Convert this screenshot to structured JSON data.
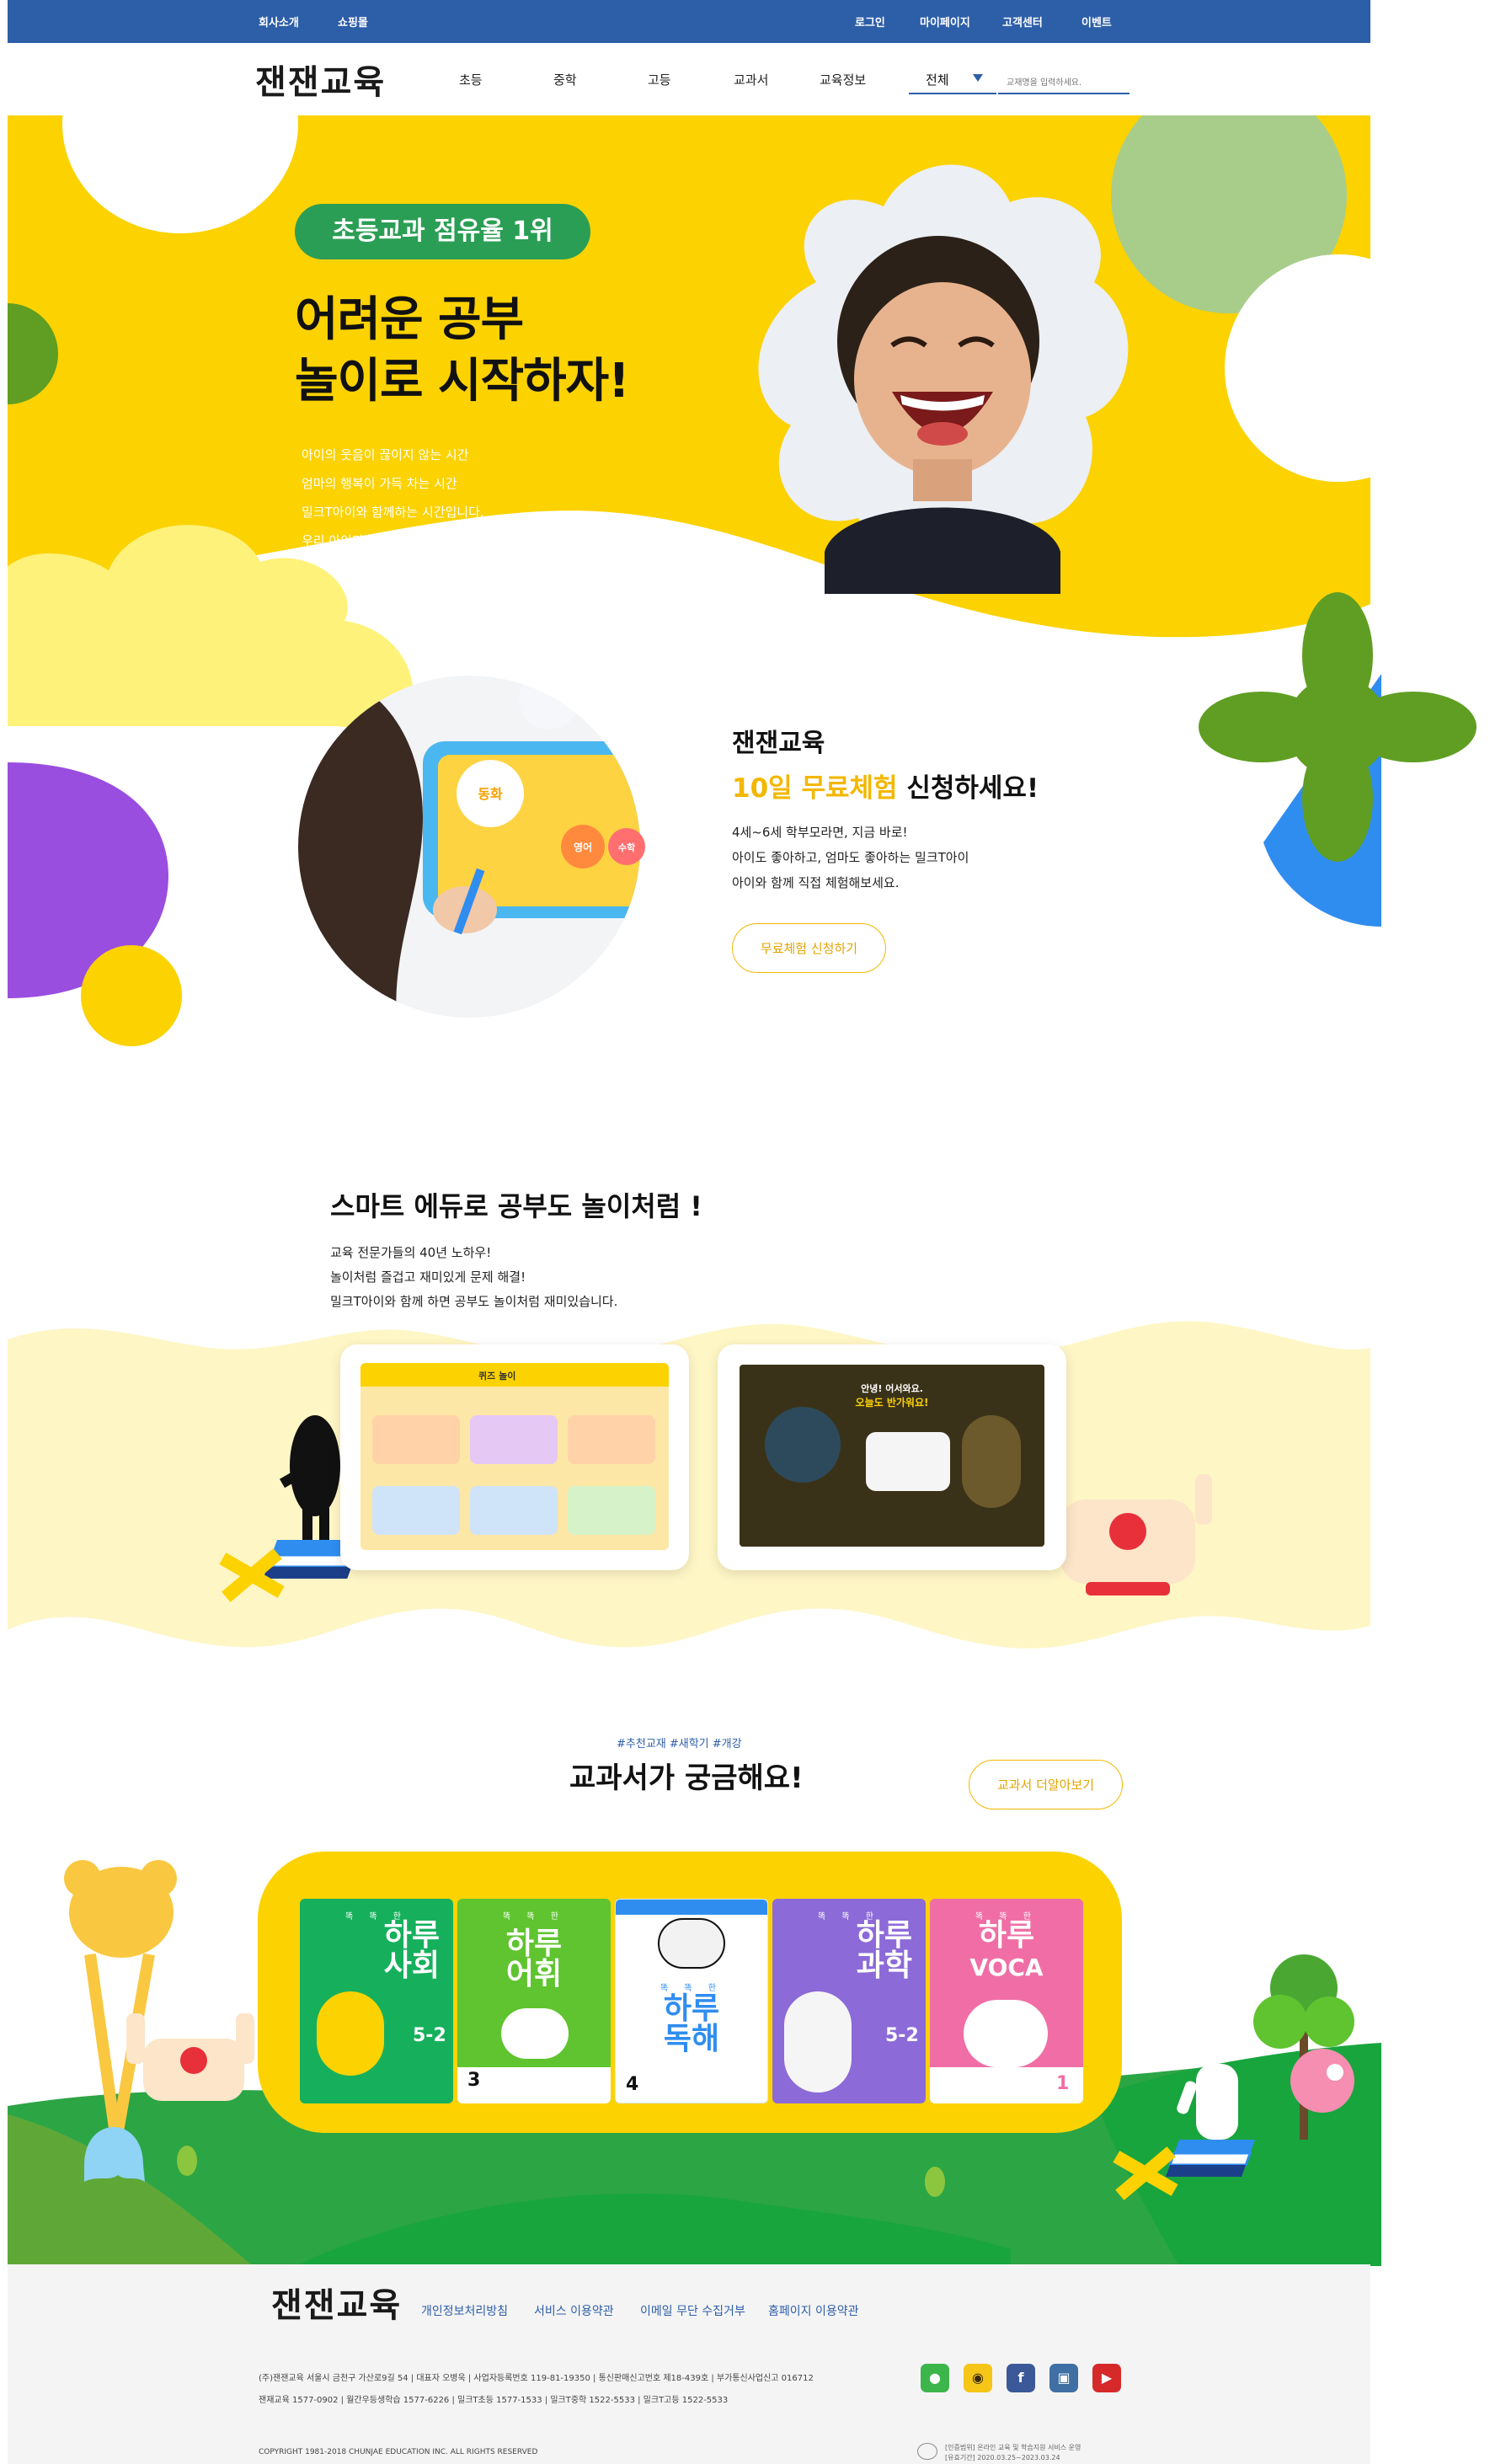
{
  "topbar": {
    "left_links": [
      "회사소개",
      "쇼핑몰"
    ],
    "right_links": [
      "로그인",
      "마이페이지",
      "고객센터",
      "이벤트"
    ]
  },
  "nav": {
    "logo": "잰잰교육",
    "menu": [
      "초등",
      "중학",
      "고등",
      "교과서",
      "교육정보"
    ],
    "select_value": "전체",
    "search_placeholder": "교재명을 입력하세요."
  },
  "hero": {
    "badge": "초등교과 점유율 1위",
    "headline_line1": "어려운 공부",
    "headline_line2": "놀이로 시작하자!",
    "lines": [
      "아이의 웃음이 끊이지 않는 시간",
      "엄마의 행복이 가득 차는 시간",
      "밀크T아이와 함께하는 시간입니다.",
      "우리 아이만을 위한 특별한 커리큘럼, 잰잰교육"
    ]
  },
  "trial": {
    "title": "잰잰교육",
    "highlight": "10일 무료체험",
    "rest": " 신청하세요!",
    "lines": [
      "4세~6세 학부모라면, 지금 바로!",
      "아이도 좋아하고, 엄마도 좋아하는 밀크T아이",
      "아이와 함께 직접 체험해보세요."
    ],
    "button": "무료체험 신청하기",
    "tablet_labels": [
      "동화",
      "영어",
      "수학"
    ]
  },
  "smart": {
    "title": "스마트 에듀로 공부도 놀이처럼 !",
    "lines": [
      "교육 전문가들의 40년 노하우!",
      "놀이처럼 즐겁고 재미있게 문제 해결!",
      "밀크T아이와 함께 하면 공부도 놀이처럼 재미있습니다."
    ],
    "screen1_title": "퀴즈 놀이",
    "screen2_greeting": "안녕! 어서와요.",
    "screen2_sub": "오늘도 반가워요!"
  },
  "textbooks": {
    "tags": "#추천교재 #새학기 #개강",
    "title": "교과서가 궁금해요!",
    "more_button": "교과서 더알아보기",
    "books": [
      {
        "sub": "똑 똑 한",
        "title1": "하루",
        "title2": "사회",
        "grade": "5-2",
        "color": "#16b05d"
      },
      {
        "sub": "똑 똑 한",
        "title1": "하루",
        "title2": "어휘",
        "grade": "3",
        "color": "#5fc42f"
      },
      {
        "sub": "똑 똑 한",
        "title1": "하루",
        "title2": "독해",
        "grade": "4",
        "color": "#ffffff"
      },
      {
        "sub": "똑 똑 한",
        "title1": "하루",
        "title2": "과학",
        "grade": "5-2",
        "color": "#8c6ad8"
      },
      {
        "sub": "똑 똑 한",
        "title1": "하루",
        "title2": "VOCA",
        "grade": "1",
        "color": "#f06ea5"
      }
    ]
  },
  "footer": {
    "logo": "잰잰교육",
    "links": [
      "개인정보처리방침",
      "서비스 이용약관",
      "이메일 무단 수집거부",
      "홈페이지 이용약관"
    ],
    "info_line1": "(주)잰잰교육 서울시 금천구 가산로9길 54 | 대표자 오병욱 | 사업자등록번호 119-81-19350 | 통신판매신고번호 제18-439호 | 부가통신사업신고 016712",
    "info_line2": "잰재교육 1577-0902 | 월간우등생학습 1577-6226 | 밀크T초등 1577-1533 | 밀크T중학 1522-5533 | 밀크T고등 1522-5533",
    "copyright": "COPYRIGHT 1981-2018 CHUNJAE EDUCATION INC. ALL RIGHTS RESERVED",
    "cert_line1": "[인증범위] 온라인 교육 및 학습지원 서비스 운영",
    "cert_line2": "[유효기간] 2020.03.25~2023.03.24",
    "sns": [
      "talk-icon",
      "kakao-icon",
      "facebook-icon",
      "instagram-icon",
      "youtube-icon"
    ]
  },
  "colors": {
    "topbar": "#2d5ea8",
    "hero_yellow": "#fcd200",
    "badge_green": "#2b9e55",
    "accent_yellow": "#f3b700",
    "grass_green": "#18a53e"
  }
}
